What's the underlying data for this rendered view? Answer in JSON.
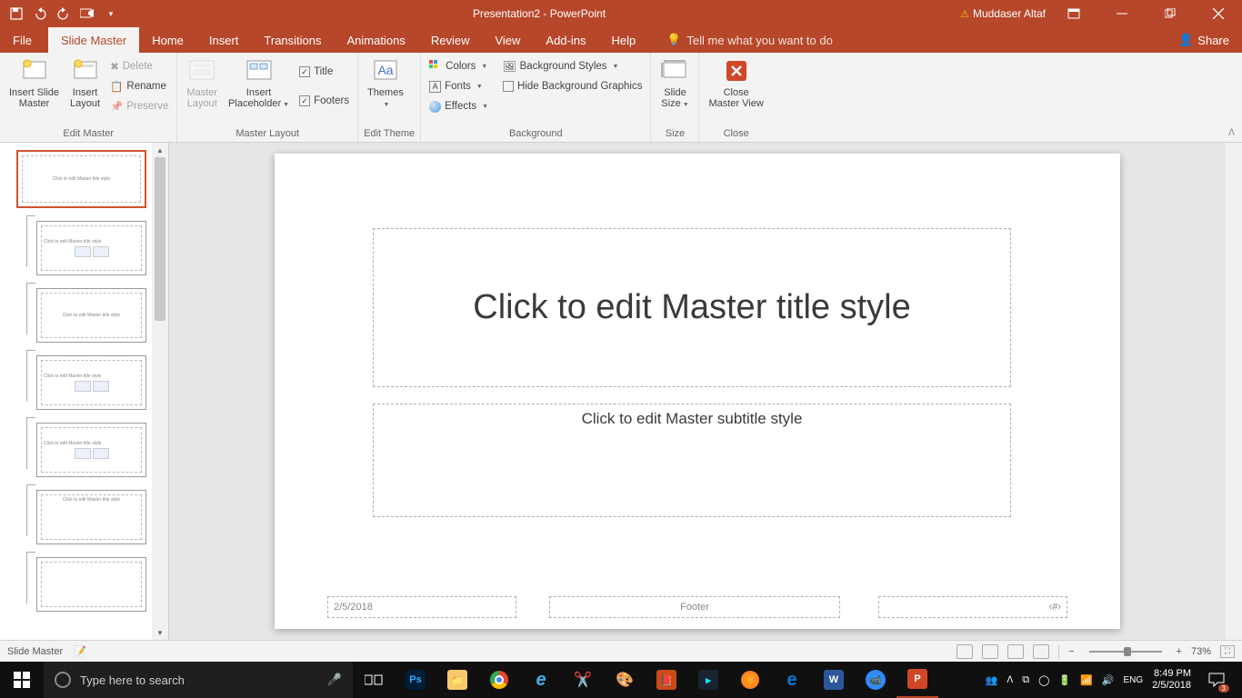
{
  "titlebar": {
    "doc_title": "Presentation2 - PowerPoint",
    "username": "Muddaser Altaf"
  },
  "tabs": {
    "file": "File",
    "slide_master": "Slide Master",
    "home": "Home",
    "insert": "Insert",
    "transitions": "Transitions",
    "animations": "Animations",
    "review": "Review",
    "view": "View",
    "addins": "Add-ins",
    "help": "Help",
    "tellme": "Tell me what you want to do",
    "share": "Share"
  },
  "ribbon": {
    "edit_master": {
      "label": "Edit Master",
      "insert_slide_master": "Insert Slide\nMaster",
      "insert_layout": "Insert\nLayout",
      "delete": "Delete",
      "rename": "Rename",
      "preserve": "Preserve"
    },
    "master_layout": {
      "label": "Master Layout",
      "master_layout_btn": "Master\nLayout",
      "insert_placeholder": "Insert\nPlaceholder",
      "title_chk": "Title",
      "footers_chk": "Footers"
    },
    "edit_theme": {
      "label": "Edit Theme",
      "themes": "Themes"
    },
    "background": {
      "label": "Background",
      "colors": "Colors",
      "fonts": "Fonts",
      "effects": "Effects",
      "bg_styles": "Background Styles",
      "hide_bg": "Hide Background Graphics"
    },
    "size": {
      "label": "Size",
      "slide_size": "Slide\nSize"
    },
    "close": {
      "label": "Close",
      "close_btn": "Close\nMaster View"
    }
  },
  "thumbs": {
    "master_text": "Click to edit Master title style",
    "layout_text": "Click to edit Master title style"
  },
  "slide": {
    "title_ph": "Click to edit Master title style",
    "subtitle_ph": "Click to edit Master subtitle style",
    "date_ph": "2/5/2018",
    "footer_ph": "Footer",
    "number_ph": "‹#›"
  },
  "status": {
    "mode": "Slide Master",
    "zoom": "73%"
  },
  "taskbar": {
    "search_placeholder": "Type here to search",
    "time": "8:49 PM",
    "date": "2/5/2018",
    "notif_count": "3"
  }
}
